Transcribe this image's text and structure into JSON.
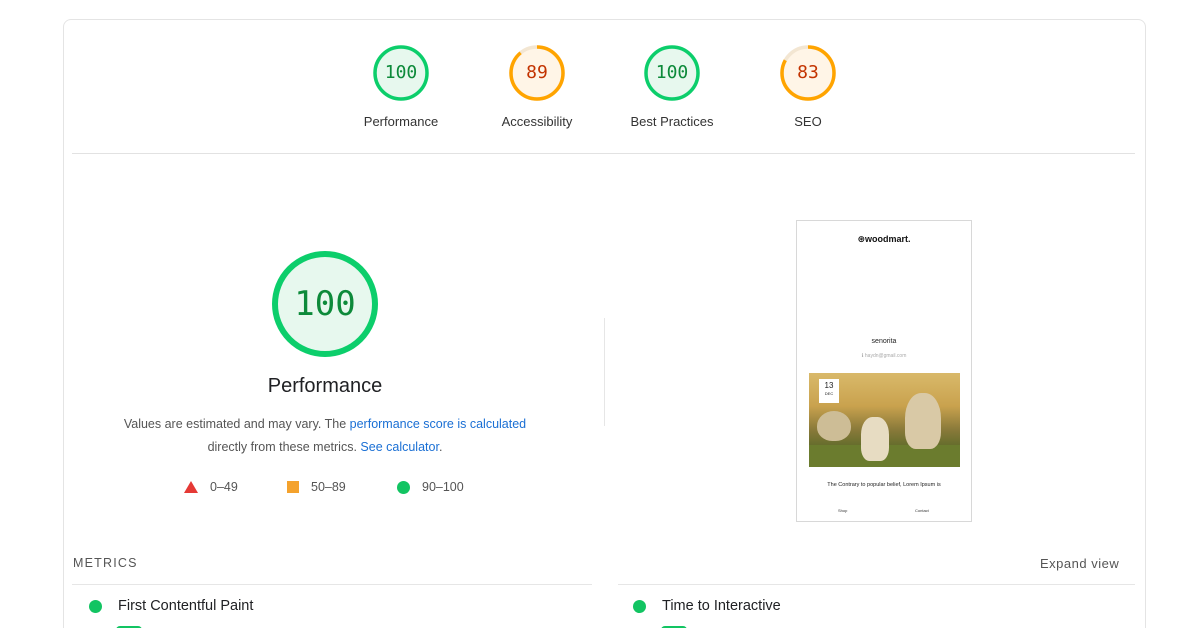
{
  "categories": [
    {
      "score": "100",
      "score_value": 100,
      "label": "Performance",
      "color": "#0cce6b",
      "text_color": "#0d8a3a"
    },
    {
      "score": "89",
      "score_value": 89,
      "label": "Accessibility",
      "color": "#ffa400",
      "text_color": "#c33300"
    },
    {
      "score": "100",
      "score_value": 100,
      "label": "Best Practices",
      "color": "#0cce6b",
      "text_color": "#0d8a3a"
    },
    {
      "score": "83",
      "score_value": 83,
      "label": "SEO",
      "color": "#ffa400",
      "text_color": "#c33300"
    }
  ],
  "performance": {
    "score": "100",
    "title": "Performance",
    "desc_prefix": "Values are estimated and may vary. The ",
    "desc_link": "performance score is calculated",
    "desc_middle": "directly from these metrics. ",
    "desc_link2": "See calculator",
    "desc_suffix": "."
  },
  "legend": [
    {
      "icon": "triangle-fail-icon",
      "range": "0–49",
      "color": "#e53935"
    },
    {
      "icon": "square-average-icon",
      "range": "50–89",
      "color": "#f4a22d"
    },
    {
      "icon": "circle-pass-icon",
      "range": "90–100",
      "color": "#12c462"
    }
  ],
  "screenshot": {
    "brand": "⊛woodmart.",
    "name": "senorita",
    "email": "ℹ haydn@gmail.com",
    "date_day": "13",
    "date_month": "DEC",
    "caption": "The Contrary to popular belief, Lorem Ipsum is",
    "nav_left": "Shop",
    "nav_right": "Contact"
  },
  "metrics": {
    "section_title": "METRICS",
    "expand_label": "Expand view",
    "items": [
      {
        "label": "First Contentful Paint",
        "status": "pass"
      },
      {
        "label": "Time to Interactive",
        "status": "pass"
      }
    ]
  }
}
